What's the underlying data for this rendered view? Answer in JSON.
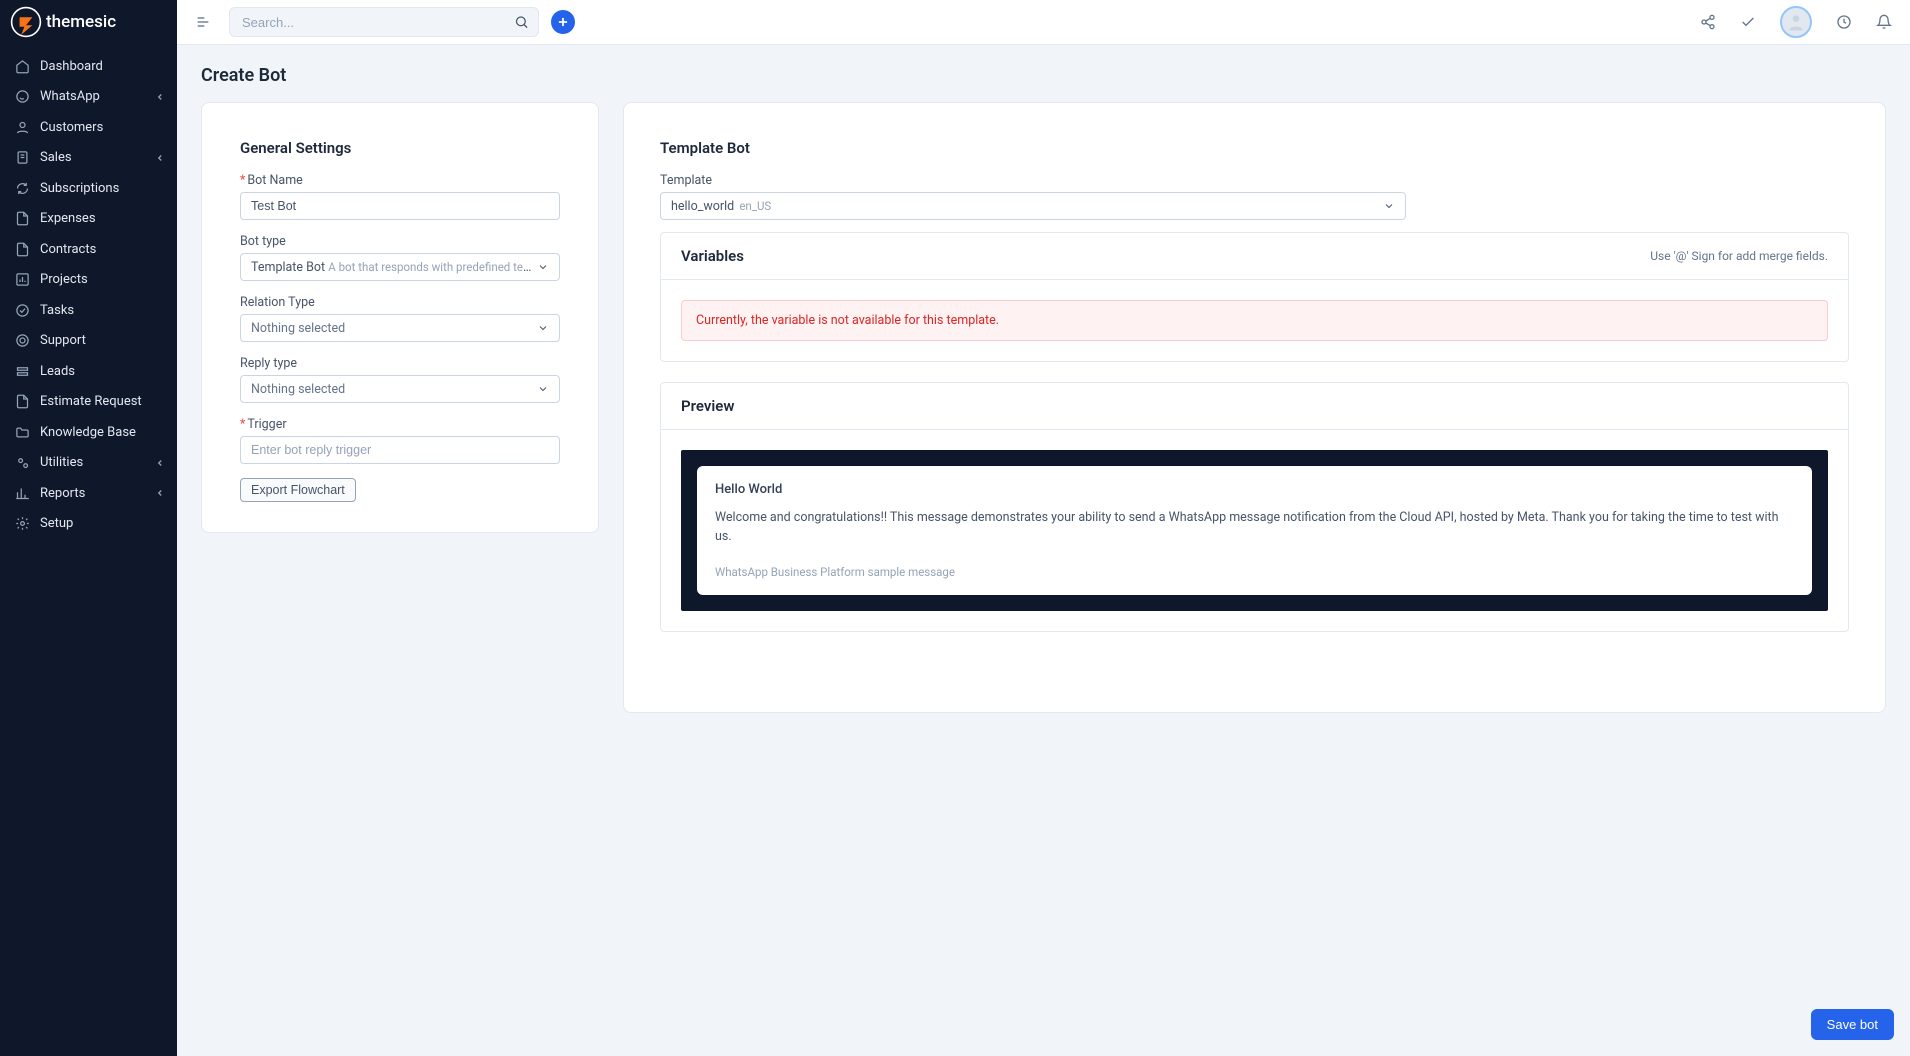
{
  "brand": "themesic",
  "search": {
    "placeholder": "Search..."
  },
  "sidebar": {
    "items": [
      {
        "label": "Dashboard",
        "icon": "home",
        "expand": false
      },
      {
        "label": "WhatsApp",
        "icon": "whatsapp",
        "expand": true
      },
      {
        "label": "Customers",
        "icon": "user",
        "expand": false
      },
      {
        "label": "Sales",
        "icon": "file",
        "expand": true
      },
      {
        "label": "Subscriptions",
        "icon": "refresh",
        "expand": false
      },
      {
        "label": "Expenses",
        "icon": "doc",
        "expand": false
      },
      {
        "label": "Contracts",
        "icon": "doc",
        "expand": false
      },
      {
        "label": "Projects",
        "icon": "chart",
        "expand": false
      },
      {
        "label": "Tasks",
        "icon": "check-circle",
        "expand": false
      },
      {
        "label": "Support",
        "icon": "life-ring",
        "expand": false
      },
      {
        "label": "Leads",
        "icon": "leads",
        "expand": false
      },
      {
        "label": "Estimate Request",
        "icon": "doc",
        "expand": false
      },
      {
        "label": "Knowledge Base",
        "icon": "folder",
        "expand": false
      },
      {
        "label": "Utilities",
        "icon": "gears",
        "expand": true
      },
      {
        "label": "Reports",
        "icon": "bar-chart",
        "expand": true
      },
      {
        "label": "Setup",
        "icon": "gear",
        "expand": false
      }
    ]
  },
  "page": {
    "title": "Create Bot"
  },
  "general": {
    "title": "General Settings",
    "bot_name_label": "Bot Name",
    "bot_name_value": "Test Bot",
    "bot_type_label": "Bot type",
    "bot_type_value": "Template Bot",
    "bot_type_desc": "A bot that responds with predefined templates...",
    "relation_label": "Relation Type",
    "relation_value": "Nothing selected",
    "reply_type_label": "Reply type",
    "reply_type_value": "Nothing selected",
    "trigger_label": "Trigger",
    "trigger_placeholder": "Enter bot reply trigger",
    "export_button": "Export Flowchart"
  },
  "template": {
    "title": "Template Bot",
    "label": "Template",
    "selected_name": "hello_world",
    "selected_lang": "en_US"
  },
  "variables": {
    "title": "Variables",
    "hint": "Use '@' Sign for add merge fields.",
    "error": "Currently, the variable is not available for this template."
  },
  "preview": {
    "title": "Preview",
    "header": "Hello World",
    "body": "Welcome and congratulations!! This message demonstrates your ability to send a WhatsApp message notification from the Cloud API, hosted by Meta. Thank you for taking the time to test with us.",
    "footer": "WhatsApp Business Platform sample message"
  },
  "save_button": "Save bot"
}
